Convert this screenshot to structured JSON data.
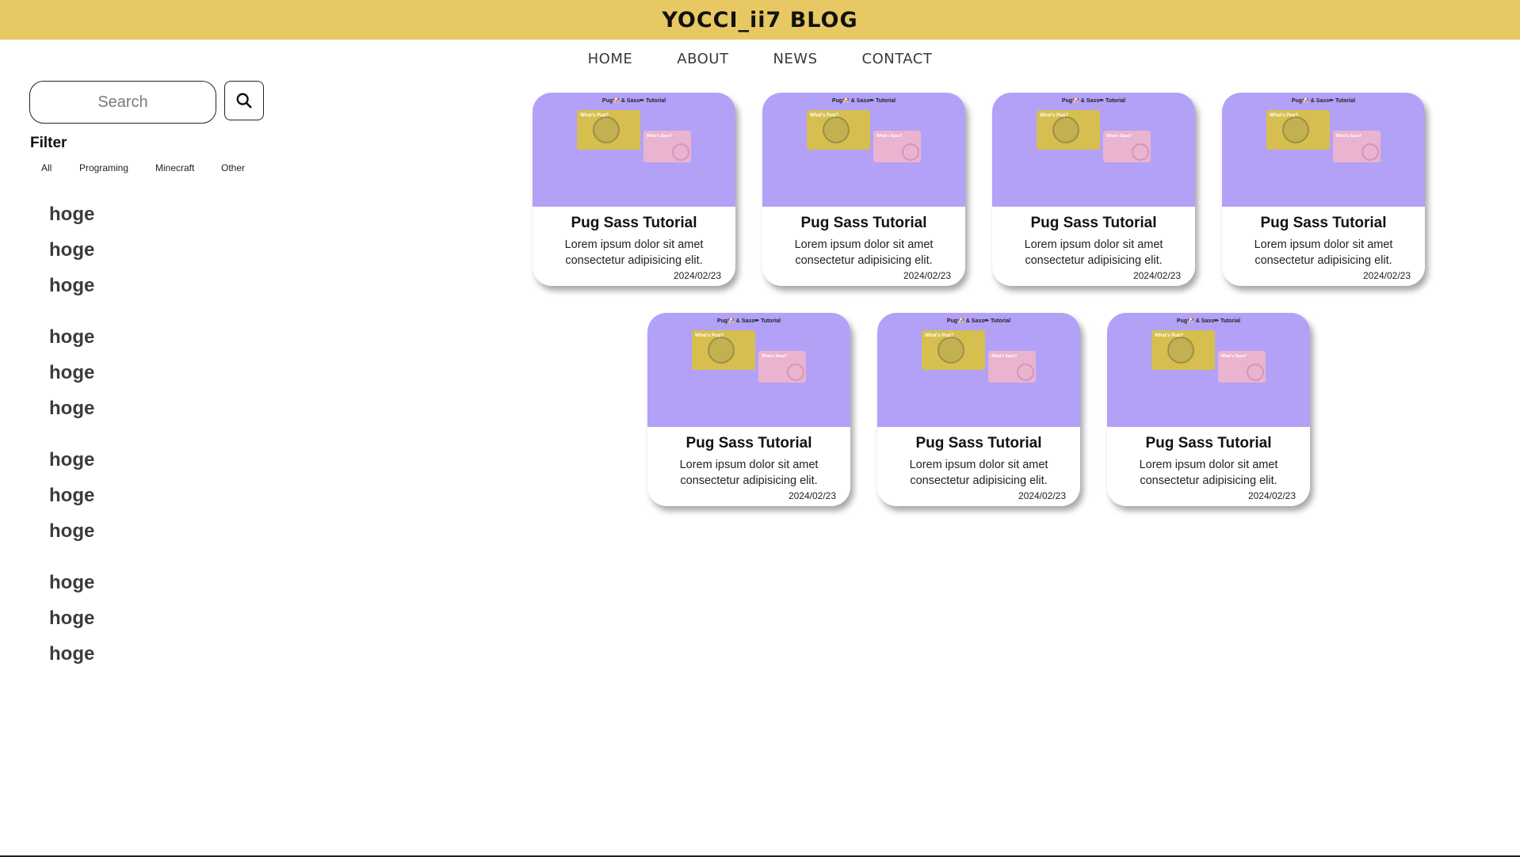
{
  "header": {
    "title": "YOCCI_ii7 BLOG",
    "background": "#e8c862"
  },
  "nav": {
    "items": [
      "HOME",
      "ABOUT",
      "NEWS",
      "CONTACT"
    ]
  },
  "sidebar": {
    "search": {
      "placeholder": "Search",
      "button_icon": "search-icon"
    },
    "filter": {
      "title": "Filter",
      "options": [
        "All",
        "Programing",
        "Minecraft",
        "Other"
      ]
    },
    "groups": [
      [
        "hoge",
        "hoge",
        "hoge"
      ],
      [
        "hoge",
        "hoge",
        "hoge"
      ],
      [
        "hoge",
        "hoge",
        "hoge"
      ],
      [
        "hoge",
        "hoge",
        "hoge"
      ]
    ]
  },
  "cards": [
    {
      "thumb_title": "Pug🐶 & Sass✏ Tutorial",
      "thumb_label1": "What's Pug?",
      "thumb_label2": "What's Sass?",
      "title": "Pug Sass Tutorial",
      "desc": "Lorem ipsum dolor sit amet consectetur adipisicing elit.",
      "date": "2024/02/23"
    },
    {
      "thumb_title": "Pug🐶 & Sass✏ Tutorial",
      "thumb_label1": "What's Pug?",
      "thumb_label2": "What's Sass?",
      "title": "Pug Sass Tutorial",
      "desc": "Lorem ipsum dolor sit amet consectetur adipisicing elit.",
      "date": "2024/02/23"
    },
    {
      "thumb_title": "Pug🐶 & Sass✏ Tutorial",
      "thumb_label1": "What's Pug?",
      "thumb_label2": "What's Sass?",
      "title": "Pug Sass Tutorial",
      "desc": "Lorem ipsum dolor sit amet consectetur adipisicing elit.",
      "date": "2024/02/23"
    },
    {
      "thumb_title": "Pug🐶 & Sass✏ Tutorial",
      "thumb_label1": "What's Pug?",
      "thumb_label2": "What's Sass?",
      "title": "Pug Sass Tutorial",
      "desc": "Lorem ipsum dolor sit amet consectetur adipisicing elit.",
      "date": "2024/02/23"
    },
    {
      "thumb_title": "Pug🐶 & Sass✏ Tutorial",
      "thumb_label1": "What's Pug?",
      "thumb_label2": "What's Sass?",
      "title": "Pug Sass Tutorial",
      "desc": "Lorem ipsum dolor sit amet consectetur adipisicing elit.",
      "date": "2024/02/23"
    },
    {
      "thumb_title": "Pug🐶 & Sass✏ Tutorial",
      "thumb_label1": "What's Pug?",
      "thumb_label2": "What's Sass?",
      "title": "Pug Sass Tutorial",
      "desc": "Lorem ipsum dolor sit amet consectetur adipisicing elit.",
      "date": "2024/02/23"
    },
    {
      "thumb_title": "Pug🐶 & Sass✏ Tutorial",
      "thumb_label1": "What's Pug?",
      "thumb_label2": "What's Sass?",
      "title": "Pug Sass Tutorial",
      "desc": "Lorem ipsum dolor sit amet consectetur adipisicing elit.",
      "date": "2024/02/23"
    }
  ],
  "colors": {
    "card_thumb": "#b2a1f6",
    "accent_yellow": "#d6bf4e",
    "accent_pink": "#eab3cf"
  }
}
